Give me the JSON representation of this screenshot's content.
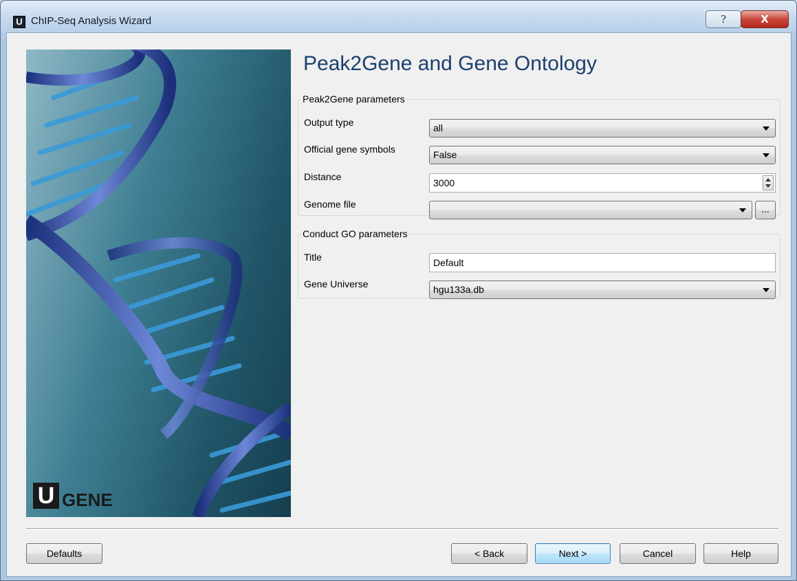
{
  "window": {
    "app_icon_letter": "U",
    "title": "ChIP-Seq Analysis Wizard",
    "help_glyph": "?",
    "close_glyph": "X"
  },
  "sidebar_logo": {
    "letter": "U",
    "text": "GENE"
  },
  "page": {
    "title": "Peak2Gene and Gene Ontology"
  },
  "peak2gene": {
    "legend": "Peak2Gene parameters",
    "output_type": {
      "label": "Output type",
      "value": "all"
    },
    "official_gene_symbols": {
      "label": "Official gene symbols",
      "value": "False"
    },
    "distance": {
      "label": "Distance",
      "value": "3000"
    },
    "genome_file": {
      "label": "Genome file",
      "value": "",
      "browse_label": "..."
    }
  },
  "conduct_go": {
    "legend": "Conduct GO parameters",
    "title": {
      "label": "Title",
      "value": "Default"
    },
    "gene_universe": {
      "label": "Gene Universe",
      "value": "hgu133a.db"
    }
  },
  "buttons": {
    "defaults": "Defaults",
    "back": "< Back",
    "next": "Next >",
    "cancel": "Cancel",
    "help": "Help"
  },
  "colors": {
    "title_color": "#1c3f6e",
    "dna_strand": "#2a4fa8",
    "dna_rung": "#2f8fd0"
  },
  "icons": [
    "help-icon",
    "close-icon",
    "dropdown-arrow-icon",
    "spin-up-icon",
    "spin-down-icon"
  ]
}
